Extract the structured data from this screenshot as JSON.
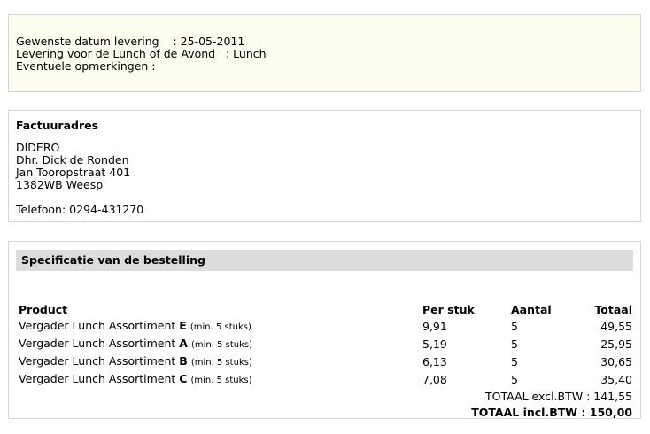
{
  "delivery": {
    "date_line": "Gewenste datum levering    : 25-05-2011",
    "time_line": "Levering voor de Lunch of de Avond   : Lunch",
    "remarks_line": "Eventuele opmerkingen :"
  },
  "invoice": {
    "title": "Factuuradres",
    "company": "DIDERO",
    "contact": "Dhr. Dick de Ronden",
    "street": "Jan Tooropstraat 401",
    "city": "1382WB Weesp",
    "phone": "Telefoon: 0294-431270"
  },
  "spec": {
    "title": "Specificatie van de bestelling",
    "headers": {
      "product": "Product",
      "price": "Per stuk",
      "qty": "Aantal",
      "total": "Totaal"
    },
    "rows": [
      {
        "name": "Vergader Lunch Assortiment",
        "letter": "E",
        "min": "(min. 5 stuks)",
        "price": "9,91",
        "qty": "5",
        "total": "49,55"
      },
      {
        "name": "Vergader Lunch Assortiment",
        "letter": "A",
        "min": "(min. 5 stuks)",
        "price": "5,19",
        "qty": "5",
        "total": "25,95"
      },
      {
        "name": "Vergader Lunch Assortiment",
        "letter": "B",
        "min": "(min. 5 stuks)",
        "price": "6,13",
        "qty": "5",
        "total": "30,65"
      },
      {
        "name": "Vergader Lunch Assortiment",
        "letter": "C",
        "min": "(min. 5 stuks)",
        "price": "7,08",
        "qty": "5",
        "total": "35,40"
      }
    ],
    "total_excl": "TOTAAL excl.BTW : 141,55",
    "total_incl": "TOTAAL incl.BTW : 150,00"
  }
}
